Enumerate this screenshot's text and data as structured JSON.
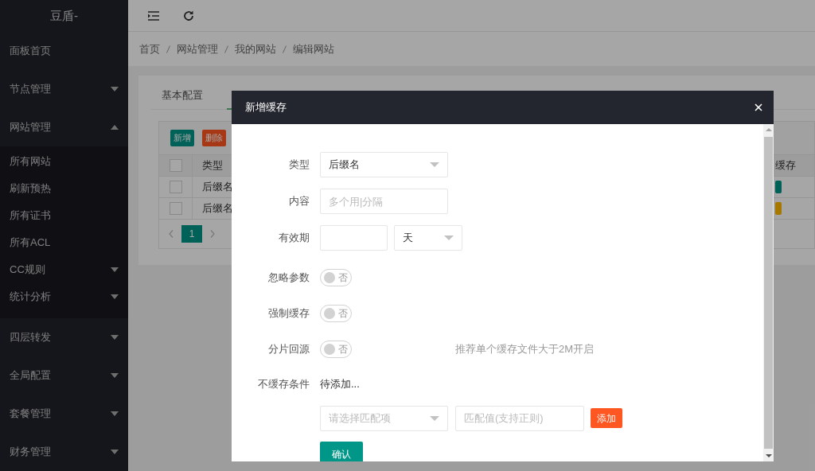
{
  "sidebar": {
    "logo": "豆盾-",
    "items": [
      {
        "label": "面板首页"
      },
      {
        "label": "节点管理",
        "expanded": false
      },
      {
        "label": "网站管理",
        "expanded": true,
        "children": [
          {
            "label": "所有网站"
          },
          {
            "label": "刷新预热"
          },
          {
            "label": "所有证书"
          },
          {
            "label": "所有ACL"
          },
          {
            "label": "CC规则",
            "expanded": false
          },
          {
            "label": "统计分析",
            "expanded": false
          }
        ]
      },
      {
        "label": "四层转发",
        "expanded": false
      },
      {
        "label": "全局配置",
        "expanded": false
      },
      {
        "label": "套餐管理",
        "expanded": false
      },
      {
        "label": "财务管理",
        "expanded": false
      }
    ]
  },
  "breadcrumb": [
    "首页",
    "网站管理",
    "我的网站",
    "编辑网站"
  ],
  "tabs": [
    {
      "label": "基本配置",
      "selected": false
    },
    {
      "selected": true
    }
  ],
  "table": {
    "toolbar": [
      {
        "label": "新增",
        "kind": "primary"
      },
      {
        "label": "删除",
        "kind": "danger"
      }
    ],
    "select_all": {
      "checked": false
    },
    "columns": [
      "类型",
      "缓存"
    ],
    "rows": [
      {
        "checked": false,
        "type": "后缀名",
        "color": "#006158"
      },
      {
        "checked": false,
        "type": "后缀名",
        "color": "#a67800"
      }
    ],
    "pagination": {
      "pages": [
        {
          "label": "1",
          "selected": true
        }
      ]
    }
  },
  "modal": {
    "title": "新增缓存",
    "fields": [
      {
        "kind": "select",
        "label": "类型",
        "value": "后缀名"
      },
      {
        "kind": "input",
        "label": "内容",
        "placeholder": "多个用|分隔"
      },
      {
        "kind": "duration",
        "label": "有效期",
        "unit": "天"
      },
      {
        "kind": "switch",
        "label": "忽略参数",
        "on": false,
        "text": "否"
      },
      {
        "kind": "switch",
        "label": "强制缓存",
        "on": false,
        "text": "否"
      },
      {
        "kind": "switch",
        "label": "分片回源",
        "on": false,
        "text": "否",
        "hint": "推荐单个缓存文件大于2M开启"
      },
      {
        "kind": "text",
        "label": "不缓存条件",
        "value": "待添加..."
      },
      {
        "kind": "condition",
        "select_placeholder": "请选择匹配项",
        "input_placeholder": "匹配值(支持正则)",
        "button": "添加"
      }
    ],
    "submit": "确认"
  }
}
